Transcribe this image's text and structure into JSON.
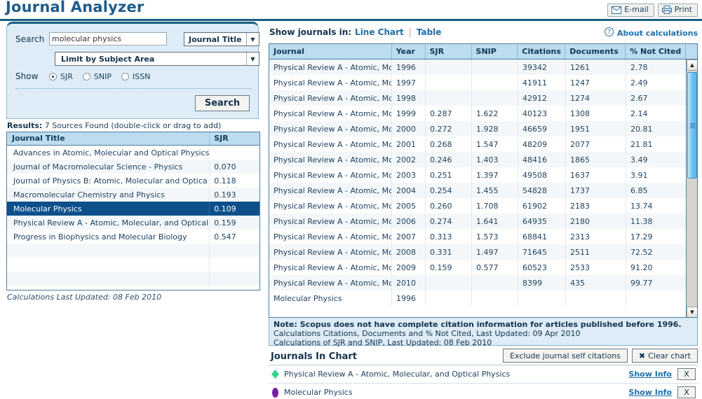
{
  "header": {
    "title": "Journal Analyzer",
    "email_label": "E-mail",
    "print_label": "Print",
    "email_icon": "envelope-icon",
    "print_icon": "printer-icon"
  },
  "search_panel": {
    "search_label": "Search",
    "search_value": "molecular physics",
    "search_placeholder": "",
    "field_dropdown_value": "Journal Title",
    "subject_dropdown_value": "Limit by Subject Area",
    "show_label": "Show",
    "radio_options": [
      {
        "label": "SJR",
        "selected": true
      },
      {
        "label": "SNIP",
        "selected": false
      },
      {
        "label": "ISSN",
        "selected": false
      }
    ],
    "search_button_label": "Search"
  },
  "results": {
    "summary_prefix": "Results:",
    "summary_text": "7 Sources Found (double-click or drag to add)",
    "columns": [
      "Journal Title",
      "SJR"
    ],
    "rows": [
      {
        "title": "Advances in Atomic, Molecular and Optical Physics",
        "sjr": ""
      },
      {
        "title": "Journal of Macromolecular Science - Physics",
        "sjr": "0.070"
      },
      {
        "title": "Journal of Physics B: Atomic, Molecular and Optica",
        "sjr": "0.118"
      },
      {
        "title": "Macromolecular Chemistry and Physics",
        "sjr": "0.193"
      },
      {
        "title": "Molecular Physics",
        "sjr": "0.109",
        "selected": true
      },
      {
        "title": "Physical Review A - Atomic, Molecular, and Optical",
        "sjr": "0.159"
      },
      {
        "title": "Progress in Biophysics and Molecular Biology",
        "sjr": "0.547"
      }
    ],
    "calculations_updated": "Calculations Last Updated: 08 Feb 2010"
  },
  "right_panel": {
    "show_journals_label": "Show journals in:",
    "view_line_chart": "Line Chart",
    "view_separator": "|",
    "view_table": "Table",
    "about_calculations": "About calculations",
    "about_icon": "question-mark-icon"
  },
  "data_table": {
    "columns": [
      "Journal",
      "Year",
      "SJR",
      "SNIP",
      "Citations",
      "Documents",
      "% Not Cited"
    ],
    "rows": [
      {
        "journal": "Physical Review A - Atomic, Mc",
        "year": "1996",
        "sjr": "",
        "snip": "",
        "citations": "39342",
        "documents": "1261",
        "pct_not_cited": "2.78"
      },
      {
        "journal": "Physical Review A - Atomic, Mc",
        "year": "1997",
        "sjr": "",
        "snip": "",
        "citations": "41911",
        "documents": "1247",
        "pct_not_cited": "2.49"
      },
      {
        "journal": "Physical Review A - Atomic, Mc",
        "year": "1998",
        "sjr": "",
        "snip": "",
        "citations": "42912",
        "documents": "1274",
        "pct_not_cited": "2.67"
      },
      {
        "journal": "Physical Review A - Atomic, Mc",
        "year": "1999",
        "sjr": "0.287",
        "snip": "1.622",
        "citations": "40123",
        "documents": "1308",
        "pct_not_cited": "2.14"
      },
      {
        "journal": "Physical Review A - Atomic, Mc",
        "year": "2000",
        "sjr": "0.272",
        "snip": "1.928",
        "citations": "46659",
        "documents": "1951",
        "pct_not_cited": "20.81"
      },
      {
        "journal": "Physical Review A - Atomic, Mc",
        "year": "2001",
        "sjr": "0.268",
        "snip": "1.547",
        "citations": "48209",
        "documents": "2077",
        "pct_not_cited": "21.81"
      },
      {
        "journal": "Physical Review A - Atomic, Mc",
        "year": "2002",
        "sjr": "0.246",
        "snip": "1.403",
        "citations": "48416",
        "documents": "1865",
        "pct_not_cited": "3.49"
      },
      {
        "journal": "Physical Review A - Atomic, Mc",
        "year": "2003",
        "sjr": "0.251",
        "snip": "1.397",
        "citations": "49508",
        "documents": "1637",
        "pct_not_cited": "3.91"
      },
      {
        "journal": "Physical Review A - Atomic, Mc",
        "year": "2004",
        "sjr": "0.254",
        "snip": "1.455",
        "citations": "54828",
        "documents": "1737",
        "pct_not_cited": "6.85"
      },
      {
        "journal": "Physical Review A - Atomic, Mc",
        "year": "2005",
        "sjr": "0.260",
        "snip": "1.708",
        "citations": "61902",
        "documents": "2183",
        "pct_not_cited": "13.74"
      },
      {
        "journal": "Physical Review A - Atomic, Mc",
        "year": "2006",
        "sjr": "0.274",
        "snip": "1.641",
        "citations": "64935",
        "documents": "2180",
        "pct_not_cited": "11.38"
      },
      {
        "journal": "Physical Review A - Atomic, Mc",
        "year": "2007",
        "sjr": "0.313",
        "snip": "1.573",
        "citations": "68841",
        "documents": "2313",
        "pct_not_cited": "17.29"
      },
      {
        "journal": "Physical Review A - Atomic, Mc",
        "year": "2008",
        "sjr": "0.331",
        "snip": "1.497",
        "citations": "71645",
        "documents": "2511",
        "pct_not_cited": "72.52"
      },
      {
        "journal": "Physical Review A - Atomic, Mc",
        "year": "2009",
        "sjr": "0.159",
        "snip": "0.577",
        "citations": "60523",
        "documents": "2533",
        "pct_not_cited": "91.20"
      },
      {
        "journal": "Physical Review A - Atomic, Mc",
        "year": "2010",
        "sjr": "",
        "snip": "",
        "citations": "8399",
        "documents": "435",
        "pct_not_cited": "99.77"
      },
      {
        "journal": "Molecular Physics",
        "year": "1996",
        "sjr": "",
        "snip": "",
        "citations": "",
        "documents": "",
        "pct_not_cited": ""
      }
    ]
  },
  "note": {
    "line1": "Note: Scopus does not have complete citation information for articles published before 1996.",
    "line2": "Calculations Citations, Documents and % Not Cited, Last Updated: 09 Apr 2010",
    "line3": "Calculations of SJR and SNIP, Last Updated: 08 Feb 2010"
  },
  "journals_in_chart": {
    "title": "Journals In Chart",
    "exclude_button": "Exclude journal self citations",
    "clear_button": "Clear chart",
    "clear_icon": "x-icon",
    "entries": [
      {
        "name": "Physical Review A - Atomic, Molecular, and Optical Physics",
        "color": "#2fd68a",
        "marker": "diamond",
        "show_info": "Show Info",
        "remove_label": "X"
      },
      {
        "name": "Molecular Physics",
        "color": "#7b1fa2",
        "marker": "ellipse",
        "show_info": "Show Info",
        "remove_label": "X"
      }
    ]
  },
  "colors": {
    "brand_blue": "#205c8a",
    "rule_blue": "#1b5f83",
    "panel_bg": "#ddecf6",
    "table_header_bg": "#bcdcef",
    "selected_row": "#0d4f8b",
    "link": "#1f6fa8"
  }
}
